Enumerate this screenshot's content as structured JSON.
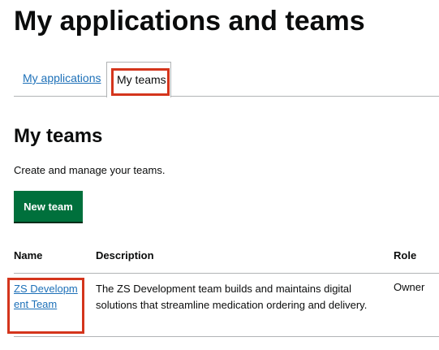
{
  "page": {
    "title": "My applications and teams"
  },
  "tabs": [
    {
      "label": "My applications",
      "selected": false
    },
    {
      "label": "My teams",
      "selected": true
    }
  ],
  "section": {
    "title": "My teams",
    "description": "Create and manage your teams.",
    "new_team_label": "New team"
  },
  "table": {
    "headers": [
      "Name",
      "Description",
      "Role"
    ],
    "rows": [
      {
        "name": "ZS Development Team",
        "description": "The ZS Development team builds and maintains digital solutions that streamline medication ordering and delivery.",
        "role": "Owner"
      }
    ]
  },
  "colors": {
    "link": "#1d70b8",
    "button": "#00703c",
    "highlight": "#d4351c",
    "border": "#b1b4b6"
  }
}
